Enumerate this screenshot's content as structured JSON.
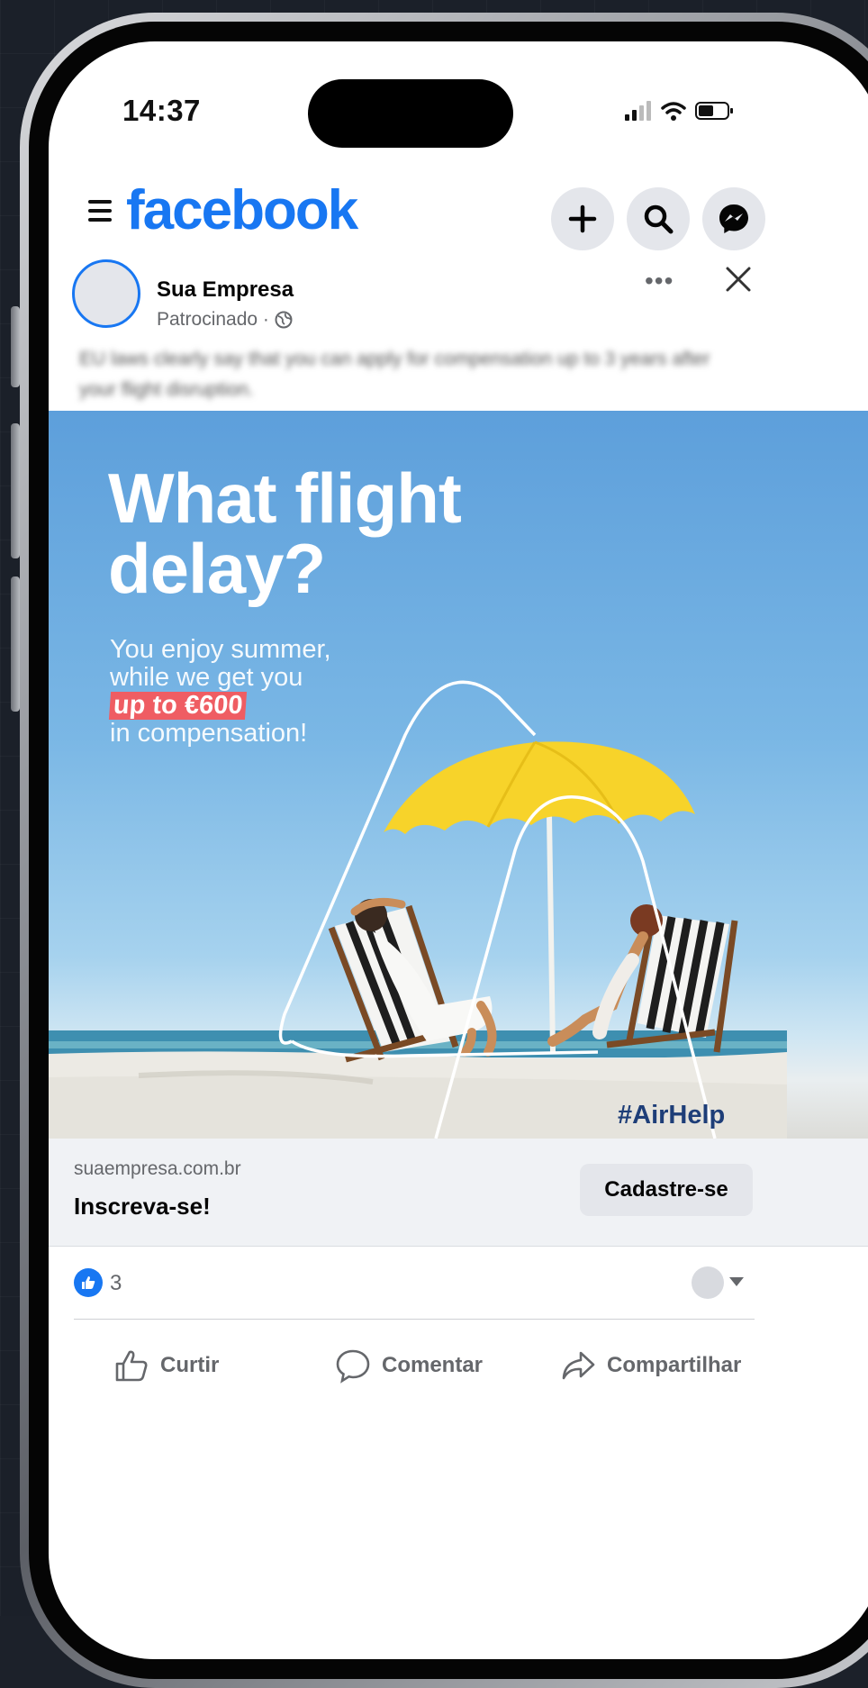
{
  "status_bar": {
    "time": "14:37",
    "icons": [
      "signal-icon",
      "wifi-icon",
      "battery-icon"
    ]
  },
  "header": {
    "logo": "facebook",
    "buttons": [
      "add-icon",
      "search-icon",
      "messenger-icon"
    ]
  },
  "post": {
    "page_name": "Sua Empresa",
    "sponsored_label": "Patrocinado ·",
    "caption": "EU laws clearly say that you can apply for compensation up to 3 years after your flight disruption.",
    "more_label": "•••"
  },
  "ad": {
    "title_line1": "What flight",
    "title_line2": "delay?",
    "sub_line1": "You enjoy summer,",
    "sub_line2": "while we get you",
    "sub_highlight": "up to €600",
    "sub_line3": "in compensation!",
    "hashtag": "#AirHelp"
  },
  "link": {
    "domain": "suaempresa.com.br",
    "headline": "Inscreva-se!",
    "cta": "Cadastre-se"
  },
  "reactions": {
    "like_count": "3"
  },
  "actions": {
    "like": "Curtir",
    "comment": "Comentar",
    "share": "Compartilhar"
  },
  "colors": {
    "brand": "#1877f2",
    "highlight": "#ef5d63",
    "umbrella": "#f7d32a"
  }
}
